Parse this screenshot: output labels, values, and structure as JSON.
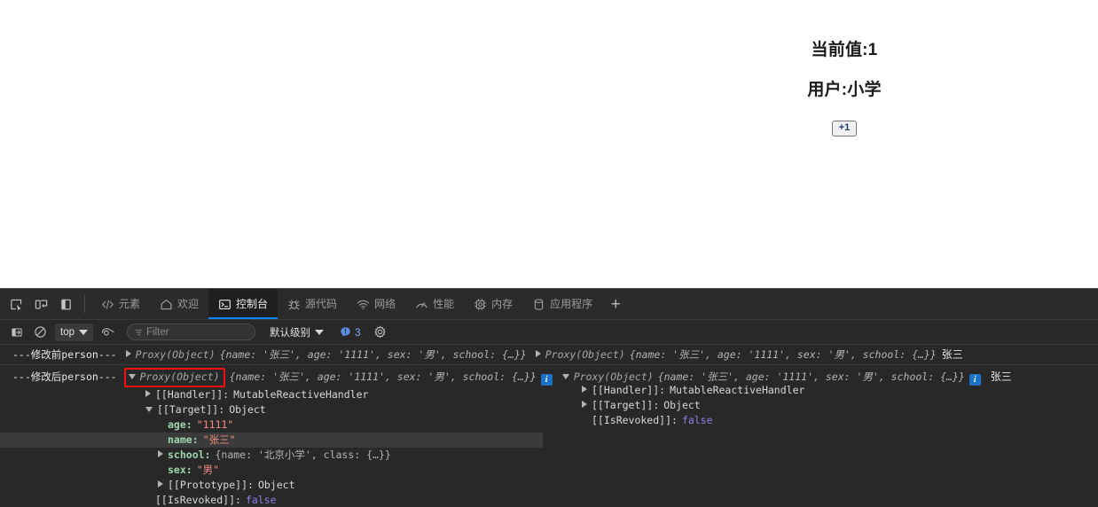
{
  "page": {
    "current_value_text": "当前值:1",
    "user_text": "用户:小学",
    "increment_button": "+1"
  },
  "devtools": {
    "toolbar_icons": [
      {
        "name": "inspect-element-icon",
        "title": "检查元素"
      },
      {
        "name": "device-toolbar-icon",
        "title": "切换设备工具栏"
      },
      {
        "name": "dock-side-icon",
        "title": "停靠位置"
      }
    ],
    "tabs": [
      {
        "label": "元素",
        "icon": "code-icon",
        "active": false
      },
      {
        "label": "欢迎",
        "icon": "home-icon",
        "active": false
      },
      {
        "label": "控制台",
        "icon": "console-icon",
        "active": true
      },
      {
        "label": "源代码",
        "icon": "bug-icon",
        "active": false
      },
      {
        "label": "网络",
        "icon": "wifi-icon",
        "active": false
      },
      {
        "label": "性能",
        "icon": "gauge-icon",
        "active": false
      },
      {
        "label": "内存",
        "icon": "chip-icon",
        "active": false
      },
      {
        "label": "应用程序",
        "icon": "database-icon",
        "active": false
      }
    ],
    "add_tab_label": "+",
    "console_toolbar": {
      "clear_console_icon": "clear-console-icon",
      "no_entry_icon": "no-entry-icon",
      "context_selector": "top",
      "eye_icon": "live-expression-icon",
      "filter_placeholder": "Filter",
      "filter_value": "",
      "level_selector": "默认级别",
      "issues_count": "3",
      "settings_icon": "gear-icon"
    }
  },
  "console": {
    "rows": [
      {
        "id": "row-before",
        "prefix_dashes_left": "---",
        "prefix_cn": "修改前",
        "prefix_word": "person",
        "prefix_dashes_right": "---",
        "left_object": {
          "expanded": false,
          "highlighted": false,
          "type": "Proxy(Object)",
          "preview": "{name: '张三', age: '1111', sex: '男', school: {…}}",
          "preview_parts": {
            "open": "{",
            "k1": "name:",
            "v1": "'张三'",
            "k2": "age:",
            "v2": "'1111'",
            "k3": "sex:",
            "v3": "'男'",
            "k4": "school:",
            "v4": "{…}",
            "close": "}"
          }
        },
        "right_object": {
          "expanded": false,
          "type": "Proxy(Object)",
          "preview": "{name: '张三', age: '1111', sex: '男', school: {…}}"
        },
        "has_info_badge_left": false,
        "has_info_badge_right": false,
        "source": "张三"
      },
      {
        "id": "row-after",
        "prefix_dashes_left": "---",
        "prefix_cn": "修改后",
        "prefix_word": "person",
        "prefix_dashes_right": "---",
        "left_object": {
          "expanded": true,
          "highlighted": true,
          "type": "Proxy(Object)",
          "preview": "{name: '张三', age: '1111', sex: '男', school: {…}}"
        },
        "right_object": {
          "expanded": true,
          "type": "Proxy(Object)",
          "preview": "{name: '张三', age: '1111', sex: '男', school: {…}}"
        },
        "has_info_badge_left": true,
        "has_info_badge_right": true,
        "source": "张三"
      }
    ],
    "left_tree": [
      {
        "arrow": "right",
        "indent": 1,
        "key": "[[Handler]]",
        "sep": ":",
        "value": "MutableReactiveHandler",
        "value_kind": "class",
        "highlight": false
      },
      {
        "arrow": "down",
        "indent": 1,
        "key": "[[Target]]",
        "sep": ":",
        "value": "Object",
        "value_kind": "class",
        "highlight": false
      },
      {
        "arrow": "none",
        "indent": 2,
        "key": "age",
        "sep": ":",
        "value": "\"1111\"",
        "value_kind": "string",
        "highlight": false
      },
      {
        "arrow": "none",
        "indent": 2,
        "key": "name",
        "sep": ":",
        "value": "\"张三\"",
        "value_kind": "string",
        "highlight": true
      },
      {
        "arrow": "right",
        "indent": 2,
        "key": "school",
        "sep": ":",
        "value": "{name: '北京小学', class: {…}}",
        "value_kind": "preview",
        "highlight": false
      },
      {
        "arrow": "none",
        "indent": 2,
        "key": "sex",
        "sep": ":",
        "value": "\"男\"",
        "value_kind": "string",
        "highlight": false
      },
      {
        "arrow": "right",
        "indent": 2,
        "key": "[[Prototype]]",
        "sep": ":",
        "value": "Object",
        "value_kind": "class",
        "highlight": false
      },
      {
        "arrow": "none",
        "indent": 1,
        "key": "[[IsRevoked]]",
        "sep": ":",
        "value": "false",
        "value_kind": "bool",
        "highlight": false
      }
    ],
    "right_tree": [
      {
        "arrow": "right",
        "indent": 1,
        "key": "[[Handler]]",
        "sep": ":",
        "value": "MutableReactiveHandler",
        "value_kind": "class"
      },
      {
        "arrow": "right",
        "indent": 1,
        "key": "[[Target]]",
        "sep": ":",
        "value": "Object",
        "value_kind": "class"
      },
      {
        "arrow": "none",
        "indent": 1,
        "key": "[[IsRevoked]]",
        "sep": ":",
        "value": "false",
        "value_kind": "bool"
      }
    ],
    "school_preview_parts": {
      "open": "{",
      "k1": "name:",
      "v1": "'北京小学'",
      "k2": "class:",
      "v2": "{…}",
      "close": "}"
    }
  }
}
